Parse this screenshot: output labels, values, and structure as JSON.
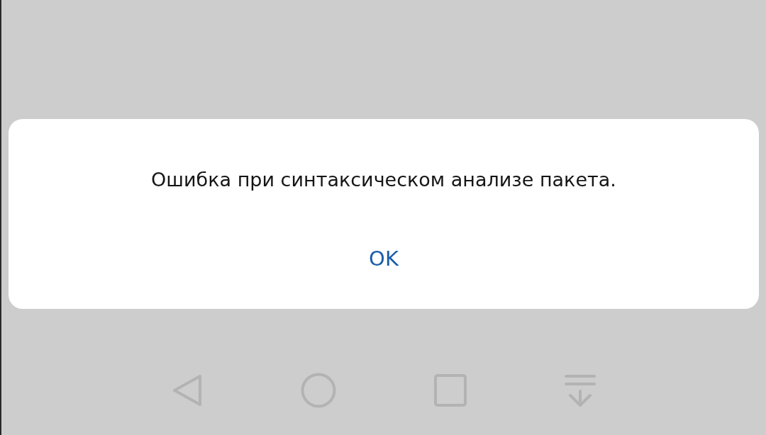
{
  "dialog": {
    "message": "Ошибка при синтаксическом анализе пакета.",
    "buttons": [
      "OK"
    ]
  }
}
